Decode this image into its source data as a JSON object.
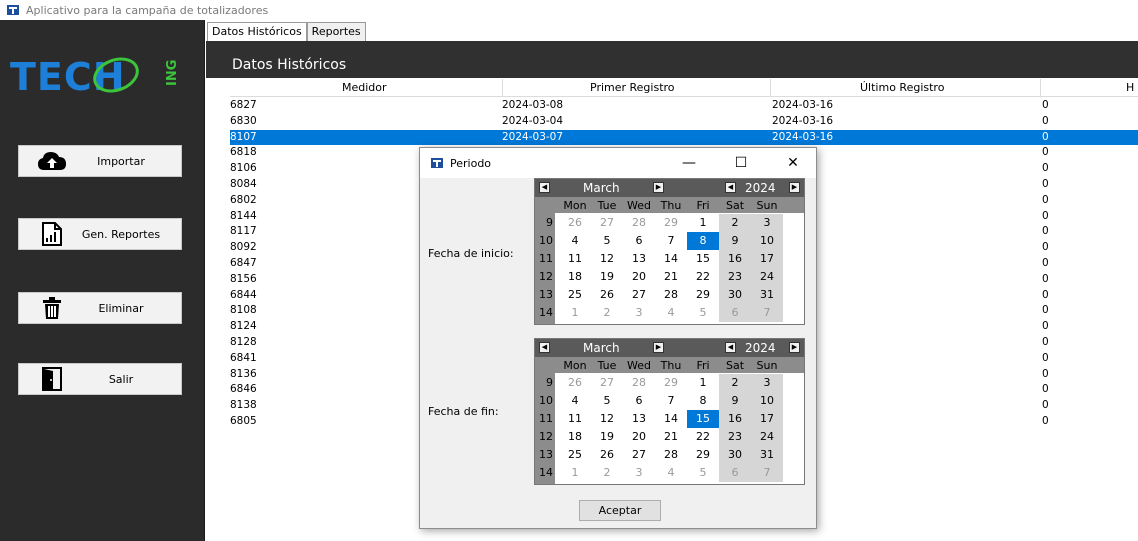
{
  "window": {
    "title": "Aplicativo para la campaña de totalizadores"
  },
  "brand": {
    "logo_text": "TECH",
    "logo_suffix": "ING"
  },
  "sidebar": {
    "buttons": [
      {
        "label": "Importar",
        "icon": "cloud-upload-icon"
      },
      {
        "label": "Gen. Reportes",
        "icon": "report-icon"
      },
      {
        "label": "Eliminar",
        "icon": "trash-icon"
      },
      {
        "label": "Salir",
        "icon": "exit-door-icon"
      }
    ]
  },
  "tabs": [
    {
      "label": "Datos Históricos",
      "active": true
    },
    {
      "label": "Reportes",
      "active": false
    }
  ],
  "section": {
    "title": "Datos Históricos"
  },
  "table": {
    "columns": [
      "Medidor",
      "Primer Registro",
      "Último Registro",
      "H"
    ],
    "rows": [
      [
        "6827",
        "2024-03-08",
        "2024-03-16",
        "0"
      ],
      [
        "6830",
        "2024-03-04",
        "2024-03-16",
        "0"
      ],
      [
        "8107",
        "2024-03-07",
        "2024-03-16",
        "0"
      ],
      [
        "6818",
        "",
        "-16",
        "0"
      ],
      [
        "8106",
        "",
        "-16",
        "0"
      ],
      [
        "8084",
        "",
        "-16",
        "0"
      ],
      [
        "6802",
        "",
        "-16",
        "0"
      ],
      [
        "8144",
        "",
        "-16",
        "0"
      ],
      [
        "8117",
        "",
        "-16",
        "0"
      ],
      [
        "8092",
        "",
        "-16",
        "0"
      ],
      [
        "6847",
        "",
        "-16",
        "0"
      ],
      [
        "8156",
        "",
        "-16",
        "0"
      ],
      [
        "6844",
        "",
        "-16",
        "0"
      ],
      [
        "8108",
        "",
        "-16",
        "0"
      ],
      [
        "8124",
        "",
        "-16",
        "0"
      ],
      [
        "8128",
        "",
        "-16",
        "0"
      ],
      [
        "6841",
        "",
        "-16",
        "0"
      ],
      [
        "8136",
        "",
        "-16",
        "0"
      ],
      [
        "6846",
        "",
        "-16",
        "0"
      ],
      [
        "8138",
        "",
        "-16",
        "0"
      ],
      [
        "6805",
        "",
        "-16",
        "0"
      ]
    ],
    "selected_row": 2
  },
  "dialog": {
    "title": "Periodo",
    "minimize_glyph": "—",
    "maximize_glyph": "☐",
    "close_glyph": "✕",
    "start_label": "Fecha de inicio:",
    "end_label": "Fecha de fin:",
    "accept_label": "Aceptar",
    "calendars": [
      {
        "month": "March",
        "year": "2024",
        "weekdays": [
          "Mon",
          "Tue",
          "Wed",
          "Thu",
          "Fri",
          "Sat",
          "Sun"
        ],
        "weeks": [
          {
            "num": "9",
            "days": [
              "26",
              "27",
              "28",
              "29",
              "1",
              "2",
              "3"
            ]
          },
          {
            "num": "10",
            "days": [
              "4",
              "5",
              "6",
              "7",
              "8",
              "9",
              "10"
            ]
          },
          {
            "num": "11",
            "days": [
              "11",
              "12",
              "13",
              "14",
              "15",
              "16",
              "17"
            ]
          },
          {
            "num": "12",
            "days": [
              "18",
              "19",
              "20",
              "21",
              "22",
              "23",
              "24"
            ]
          },
          {
            "num": "13",
            "days": [
              "25",
              "26",
              "27",
              "28",
              "29",
              "30",
              "31"
            ]
          },
          {
            "num": "14",
            "days": [
              "1",
              "2",
              "3",
              "4",
              "5",
              "6",
              "7"
            ]
          }
        ],
        "selected_day": "8"
      },
      {
        "month": "March",
        "year": "2024",
        "weekdays": [
          "Mon",
          "Tue",
          "Wed",
          "Thu",
          "Fri",
          "Sat",
          "Sun"
        ],
        "weeks": [
          {
            "num": "9",
            "days": [
              "26",
              "27",
              "28",
              "29",
              "1",
              "2",
              "3"
            ]
          },
          {
            "num": "10",
            "days": [
              "4",
              "5",
              "6",
              "7",
              "8",
              "9",
              "10"
            ]
          },
          {
            "num": "11",
            "days": [
              "11",
              "12",
              "13",
              "14",
              "15",
              "16",
              "17"
            ]
          },
          {
            "num": "12",
            "days": [
              "18",
              "19",
              "20",
              "21",
              "22",
              "23",
              "24"
            ]
          },
          {
            "num": "13",
            "days": [
              "25",
              "26",
              "27",
              "28",
              "29",
              "30",
              "31"
            ]
          },
          {
            "num": "14",
            "days": [
              "1",
              "2",
              "3",
              "4",
              "5",
              "6",
              "7"
            ]
          }
        ],
        "selected_day": "15"
      }
    ]
  },
  "colors": {
    "sidebar": "#2b2b2b",
    "header": "#303030",
    "selection": "#0078d7",
    "logo_blue": "#1e7fd8",
    "logo_green": "#3cc43c"
  }
}
